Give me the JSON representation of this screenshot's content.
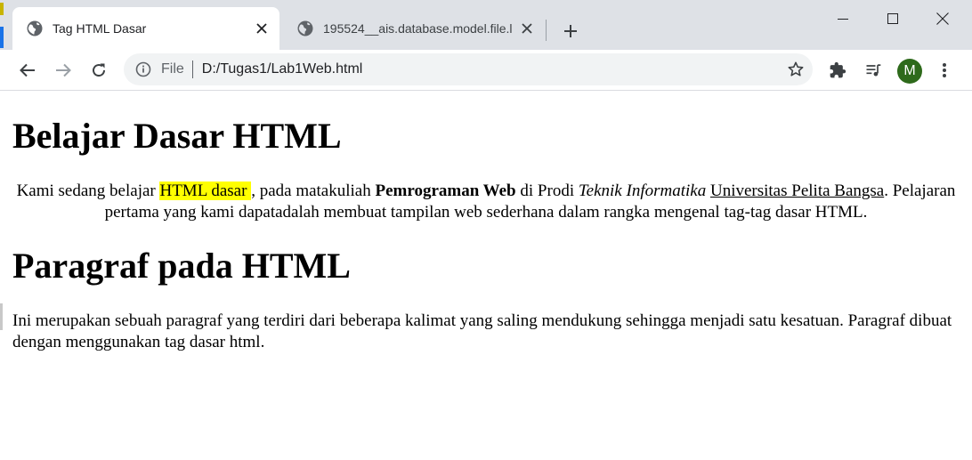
{
  "browser": {
    "tabs": [
      {
        "title": "Tag HTML Dasar",
        "active": true,
        "favicon": "globe-icon"
      },
      {
        "title": "195524__ais.database.model.file.l",
        "active": false,
        "favicon": "globe-icon"
      }
    ],
    "address": {
      "label": "File",
      "url": "D:/Tugas1/Lab1Web.html"
    },
    "profile_initial": "M"
  },
  "document": {
    "heading1": "Belajar Dasar HTML",
    "paragraph1": {
      "t1": "Kami sedang belajar ",
      "highlight": "HTML dasar ",
      "t2": ", pada matakuliah ",
      "bold": "Pemrograman Web",
      "t3": " di Prodi ",
      "italic": "Teknik Informatika",
      "t4": " ",
      "underline": "Universitas Pelita Bangsa",
      "t5": ". Pelajaran pertama yang kami dapatadalah membuat tampilan web sederhana dalam rangka mengenal tag-tag dasar HTML."
    },
    "heading2": "Paragraf pada HTML",
    "paragraph2": "Ini merupakan sebuah paragraf yang terdiri dari beberapa kalimat yang saling mendukung sehingga menjadi satu kesatuan. Paragraf dibuat dengan menggunakan tag dasar html."
  },
  "colors": {
    "tabstrip": "#dee1e6",
    "highlight": "#ffff00",
    "avatar": "#2e6a1b"
  }
}
